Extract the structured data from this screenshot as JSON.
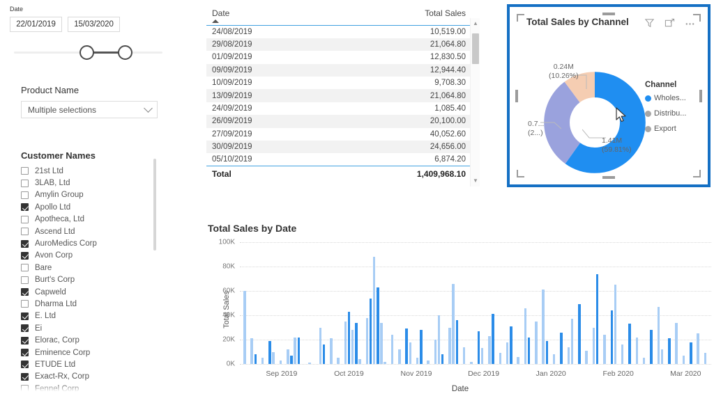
{
  "date_slicer": {
    "caption": "Date",
    "start": "22/01/2019",
    "end": "15/03/2020"
  },
  "product_slicer": {
    "title": "Product Name",
    "value": "Multiple selections"
  },
  "customer_slicer": {
    "title": "Customer Names",
    "items": [
      {
        "label": "21st Ltd",
        "checked": false
      },
      {
        "label": "3LAB, Ltd",
        "checked": false
      },
      {
        "label": "Amylin Group",
        "checked": false
      },
      {
        "label": "Apollo Ltd",
        "checked": true
      },
      {
        "label": "Apotheca, Ltd",
        "checked": false
      },
      {
        "label": "Ascend Ltd",
        "checked": false
      },
      {
        "label": "AuroMedics Corp",
        "checked": true
      },
      {
        "label": "Avon Corp",
        "checked": true
      },
      {
        "label": "Bare",
        "checked": false
      },
      {
        "label": "Burt's Corp",
        "checked": false
      },
      {
        "label": "Capweld",
        "checked": true
      },
      {
        "label": "Dharma Ltd",
        "checked": false
      },
      {
        "label": "E. Ltd",
        "checked": true
      },
      {
        "label": "Ei",
        "checked": true
      },
      {
        "label": "Elorac, Corp",
        "checked": true
      },
      {
        "label": "Eminence Corp",
        "checked": true
      },
      {
        "label": "ETUDE Ltd",
        "checked": true
      },
      {
        "label": "Exact-Rx, Corp",
        "checked": true
      },
      {
        "label": "Fennel Corp",
        "checked": false
      }
    ]
  },
  "sales_table": {
    "columns": [
      "Date",
      "Total Sales"
    ],
    "sort_column": "Date",
    "sort_direction": "ascending",
    "rows": [
      [
        "24/08/2019",
        "10,519.00"
      ],
      [
        "29/08/2019",
        "21,064.80"
      ],
      [
        "01/09/2019",
        "12,830.50"
      ],
      [
        "09/09/2019",
        "12,944.40"
      ],
      [
        "10/09/2019",
        "9,708.30"
      ],
      [
        "13/09/2019",
        "21,064.80"
      ],
      [
        "24/09/2019",
        "1,085.40"
      ],
      [
        "26/09/2019",
        "20,100.00"
      ],
      [
        "27/09/2019",
        "40,052.60"
      ],
      [
        "30/09/2019",
        "24,656.00"
      ],
      [
        "05/10/2019",
        "6,874.20"
      ]
    ],
    "total_label": "Total",
    "total_value": "1,409,968.10"
  },
  "donut_panel": {
    "title": "Total Sales by Channel",
    "icons": [
      "filter-icon",
      "focus-mode-icon",
      "more-options-icon"
    ],
    "selected": true,
    "legend_title": "Channel",
    "chart_data": {
      "type": "pie",
      "title": "Total Sales by Channel",
      "legend_position": "right",
      "legend_title": "Channel",
      "categories": [
        "Wholes...",
        "Distribu...",
        "Export"
      ],
      "values": [
        1.41,
        0.7,
        0.24
      ],
      "percentages": [
        59.81,
        29.93,
        10.26
      ],
      "colors": [
        "#1f8ef1",
        "#9aa2dd",
        "#f5cdb2"
      ],
      "labels": [
        {
          "value": "1.41M",
          "percent": "(59.81%)"
        },
        {
          "value": "0.7...",
          "percent": "(2...)"
        },
        {
          "value": "0.24M",
          "percent": "(10.26%)"
        }
      ]
    }
  },
  "bar_chart": {
    "chart_data": {
      "type": "bar",
      "title": "Total Sales by Date",
      "xlabel": "Date",
      "ylabel": "Total Sales",
      "ylim": [
        0,
        100000
      ],
      "yticks": [
        "0K",
        "20K",
        "40K",
        "60K",
        "80K",
        "100K"
      ],
      "ytick_values": [
        0,
        20000,
        40000,
        60000,
        80000,
        100000
      ],
      "xticks": [
        "Sep 2019",
        "Oct 2019",
        "Nov 2019",
        "Dec 2019",
        "Jan 2020",
        "Feb 2020",
        "Mar 2020"
      ],
      "grid": true,
      "colors": {
        "highlight": "#2b8ce8",
        "base": "#a8cdf5"
      },
      "series": [
        {
          "name": "Total Sales",
          "values": [
            [
              1,
              60,
              0
            ],
            [
              3,
              21,
              0
            ],
            [
              4,
              8,
              1
            ],
            [
              6,
              5,
              0
            ],
            [
              8,
              19,
              1
            ],
            [
              9,
              10,
              0
            ],
            [
              11,
              3,
              0
            ],
            [
              13,
              12,
              0
            ],
            [
              14,
              7,
              1
            ],
            [
              15,
              22,
              0
            ],
            [
              16,
              22,
              1
            ],
            [
              19,
              1,
              0
            ],
            [
              22,
              30,
              0
            ],
            [
              23,
              16,
              1
            ],
            [
              25,
              21,
              0
            ],
            [
              27,
              5,
              0
            ],
            [
              29,
              35,
              0
            ],
            [
              30,
              43,
              1
            ],
            [
              31,
              28,
              0
            ],
            [
              32,
              34,
              1
            ],
            [
              33,
              4,
              0
            ],
            [
              35,
              38,
              0
            ],
            [
              36,
              54,
              1
            ],
            [
              37,
              88,
              0
            ],
            [
              38,
              63,
              1
            ],
            [
              39,
              34,
              0
            ],
            [
              40,
              2,
              0
            ],
            [
              42,
              24,
              0
            ],
            [
              44,
              12,
              0
            ],
            [
              46,
              29,
              1
            ],
            [
              47,
              18,
              0
            ],
            [
              49,
              5,
              0
            ],
            [
              50,
              28,
              1
            ],
            [
              52,
              3,
              0
            ],
            [
              54,
              20,
              0
            ],
            [
              55,
              40,
              0
            ],
            [
              56,
              8,
              1
            ],
            [
              58,
              30,
              0
            ],
            [
              59,
              66,
              0
            ],
            [
              60,
              36,
              1
            ],
            [
              62,
              14,
              0
            ],
            [
              64,
              2,
              0
            ],
            [
              66,
              27,
              1
            ],
            [
              67,
              13,
              0
            ],
            [
              69,
              23,
              0
            ],
            [
              70,
              41,
              1
            ],
            [
              72,
              9,
              0
            ],
            [
              74,
              18,
              0
            ],
            [
              75,
              31,
              1
            ],
            [
              77,
              6,
              0
            ],
            [
              79,
              46,
              0
            ],
            [
              80,
              22,
              1
            ],
            [
              82,
              35,
              0
            ],
            [
              84,
              61,
              0
            ],
            [
              85,
              19,
              1
            ],
            [
              87,
              8,
              0
            ],
            [
              89,
              26,
              1
            ],
            [
              91,
              14,
              0
            ],
            [
              92,
              37,
              0
            ],
            [
              94,
              49,
              1
            ],
            [
              96,
              11,
              0
            ],
            [
              98,
              30,
              0
            ],
            [
              99,
              74,
              1
            ],
            [
              101,
              24,
              0
            ],
            [
              103,
              44,
              1
            ],
            [
              104,
              65,
              0
            ],
            [
              106,
              16,
              0
            ],
            [
              108,
              33,
              1
            ],
            [
              110,
              22,
              0
            ],
            [
              112,
              5,
              0
            ],
            [
              114,
              28,
              1
            ],
            [
              116,
              47,
              0
            ],
            [
              117,
              12,
              0
            ],
            [
              119,
              21,
              1
            ],
            [
              121,
              34,
              0
            ],
            [
              123,
              7,
              0
            ],
            [
              125,
              18,
              1
            ],
            [
              127,
              25,
              0
            ],
            [
              129,
              9,
              0
            ]
          ]
        }
      ]
    }
  }
}
